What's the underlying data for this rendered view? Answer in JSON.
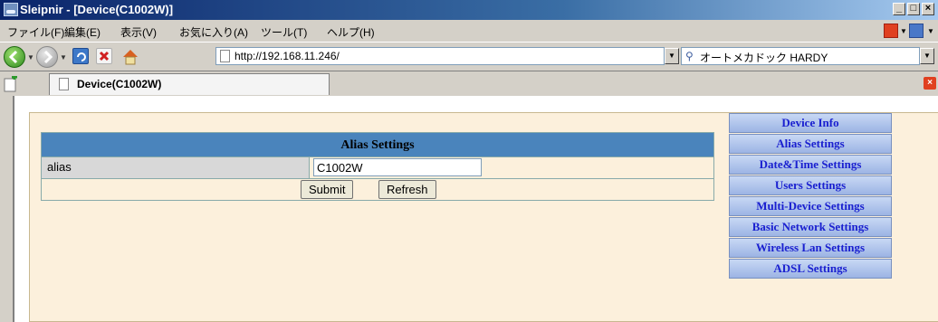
{
  "window": {
    "title": "Sleipnir - [Device(C1002W)]",
    "controls": {
      "minimize": "_",
      "maximize": "□",
      "close": "×"
    }
  },
  "menubar": {
    "items": [
      "ファイル(F)",
      "編集(E)",
      "表示(V)",
      "お気に入り(A)",
      "ツール(T)",
      "ヘルプ(H)"
    ]
  },
  "toolbar": {
    "back_icon": "back-arrow-icon",
    "forward_icon": "forward-arrow-icon",
    "address": "http://192.168.11.246/",
    "search_text": "オートメカドック HARDY"
  },
  "tabbar": {
    "active_tab": "Device(C1002W)"
  },
  "page": {
    "alias_table": {
      "header": "Alias Settings",
      "field_label": "alias",
      "field_value": "C1002W",
      "submit_label": "Submit",
      "refresh_label": "Refresh"
    },
    "nav": [
      "Device Info",
      "Alias Settings",
      "Date&Time Settings",
      "Users Settings",
      "Multi-Device Settings",
      "Basic Network Settings",
      "Wireless Lan Settings",
      "ADSL Settings"
    ]
  },
  "colors": {
    "title_bar": "#0a246a",
    "panel_bg": "#fcf0dc",
    "table_header": "#4a84bc",
    "nav_link": "#1a20d0"
  }
}
